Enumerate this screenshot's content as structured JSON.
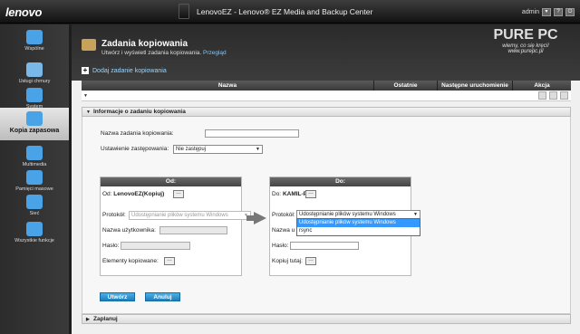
{
  "topbar": {
    "logo": "lenovo",
    "app_title": "LenovoEZ - Lenovo® EZ Media and Backup Center",
    "user": "admin"
  },
  "sidebar": {
    "items": [
      {
        "label": "Wspólne",
        "icon": "star-icon",
        "color": "#4aa3e6"
      },
      {
        "label": "Usługi chmury",
        "icon": "cloud-icon",
        "color": "#7ab8e8"
      },
      {
        "label": "System",
        "icon": "gear-icon",
        "color": "#4aa3e6"
      },
      {
        "label": "Kopia zapasowa",
        "icon": "backup-icon",
        "color": "#4aa3e6",
        "active": true
      },
      {
        "label": "Multimedia",
        "icon": "film-icon",
        "color": "#4aa3e6"
      },
      {
        "label": "Pamięci masowe",
        "icon": "storage-icon",
        "color": "#4aa3e6"
      },
      {
        "label": "Sieć",
        "icon": "network-icon",
        "color": "#4aa3e6"
      },
      {
        "label": "Wszystkie funkcje",
        "icon": "grid-icon",
        "color": "#4aa3e6"
      }
    ]
  },
  "header": {
    "title": "Zadania kopiowania",
    "subtitle": "Utwórz i wyświetl zadania kopiowania.",
    "overview_link": "Przegląd",
    "add_task": "Dodaj zadanie kopiowania"
  },
  "watermark": {
    "line1": "PURE PC",
    "line2": "wiemy, co się kręci!",
    "line3": "www.purepc.pl"
  },
  "table": {
    "columns": [
      "Nazwa",
      "Ostatnie uruchomienie",
      "Następne uruchomienie",
      "Akcja"
    ]
  },
  "task_info": {
    "section_title": "Informacje o zadaniu kopiowania",
    "name_label": "Nazwa zadania kopiowania:",
    "name_value": "",
    "replace_label": "Ustawienie zastępowania:",
    "replace_value": "Nie zastępuj"
  },
  "from": {
    "title": "Od:",
    "source_label": "Od:",
    "source_value": "LenovoEZ(Kopiuj)",
    "protocol_label": "Protokół:",
    "protocol_value": "Udostępnianie plików systemu Windows",
    "user_label": "Nazwa użytkownika:",
    "pass_label": "Hasło:",
    "elements_label": "Elementy kopiowane:"
  },
  "to": {
    "title": "Do:",
    "dest_label": "Do:",
    "dest_value": "KAMIL-PC",
    "protocol_label": "Protokół:",
    "protocol_value": "Udostępnianie plików systemu Windows",
    "user_label": "Nazwa u",
    "pass_label": "Hasło:",
    "copy_label": "Kopiuj tutaj:",
    "options": [
      "Udostępnianie plików systemu Windows",
      "rsync"
    ]
  },
  "buttons": {
    "create": "Utwórz",
    "cancel": "Anuluj"
  },
  "schedule": {
    "title": "Zaplanuj"
  }
}
